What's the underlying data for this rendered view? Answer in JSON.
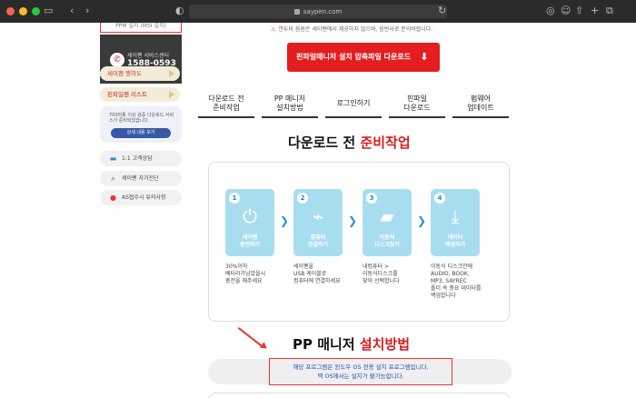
{
  "browser": {
    "url": "saypen.com",
    "lights": [
      "#ff5f57",
      "#febc2e",
      "#28c840"
    ]
  },
  "sidebar": {
    "top_box_text": "PPM 설치 (MSI 설치)",
    "cs_title": "세이펜 서비스센터",
    "cs_number": "1588-0593",
    "help_label": "세이펜 행하도",
    "list_label": "핀파일펜 리스트",
    "card_text": "700여종 이상 검증 다운로드 서비스가 준비되었습니다",
    "card_button": "상세 내용 보기",
    "link1": "1:1 고객상담",
    "link2": "세이펜 자가진단",
    "link3": "AS접수시 유의사항"
  },
  "main": {
    "notice": "연두비 음원은 세이펜에서 제공하지 않으며, 음반사로 문의바랍니다.",
    "download_button": "핀파일매니저 설치 압축파일 다운로드",
    "tabs": [
      "다운로드 전\n준비작업",
      "PP 매니저\n설치방법",
      "로그인하기",
      "핀파일\n다운로드",
      "펌웨어\n업데이트"
    ],
    "section1_title_a": "다운로드 전 ",
    "section1_title_b": "준비작업",
    "steps": [
      {
        "num": "1",
        "label": "세이펜\n충전하기",
        "desc": "30%이하\n배터리가남았을시\n충전을 해주세요"
      },
      {
        "num": "2",
        "label": "컴퓨터\n연결하기",
        "desc": "세이펜을\nUSB 케이블로\n컴퓨터에 연결하세요"
      },
      {
        "num": "3",
        "label": "이동식\n디스크찾기",
        "desc": "내컴퓨터 >\n이동식디스크를\n찾아 선택합니다"
      },
      {
        "num": "4",
        "label": "데이터\n백업하기",
        "desc": "이동식 디스크안에\nAUDIO, BOOK,\nMP3, SAYREC\n폴더 속 중요 데이터를\n백업합니다"
      }
    ],
    "section2_title_a": "PP 매니저 ",
    "section2_title_b": "설치방법",
    "info_line1": "해당 프로그램은 윈도우 OS 전용 설치 프로그램입니다.",
    "info_line2": "맥 OS에서는 설치가 불가능합니다."
  }
}
